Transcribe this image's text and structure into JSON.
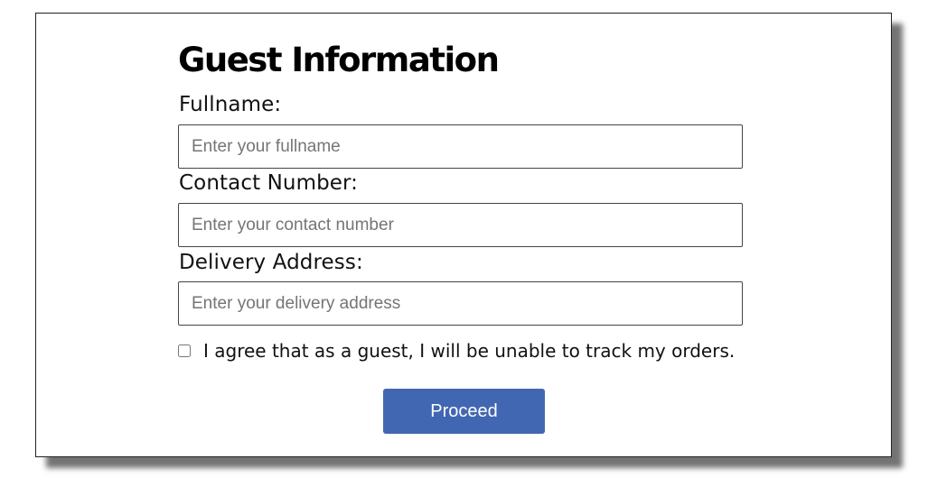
{
  "form": {
    "title": "Guest Information",
    "fullname": {
      "label": "Fullname:",
      "placeholder": "Enter your fullname",
      "value": ""
    },
    "contact": {
      "label": "Contact Number:",
      "placeholder": "Enter your contact number",
      "value": ""
    },
    "address": {
      "label": "Delivery Address:",
      "placeholder": "Enter your delivery address",
      "value": ""
    },
    "agreement": {
      "text": "I agree that as a guest, I will be unable to track my orders.",
      "checked": false
    },
    "proceed_label": "Proceed"
  },
  "colors": {
    "button": "#4267b2",
    "button_text": "#ffffff"
  }
}
